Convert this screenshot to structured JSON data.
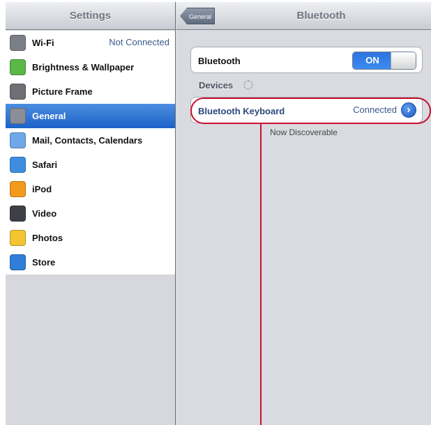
{
  "sidebar": {
    "title": "Settings",
    "items": [
      {
        "label": "Wi-Fi",
        "value": "Not Connected",
        "icon": "wifi-icon",
        "color": "#7b8088",
        "selected": false
      },
      {
        "label": "Brightness & Wallpaper",
        "icon": "brightness-icon",
        "color": "#59b848",
        "selected": false
      },
      {
        "label": "Picture Frame",
        "icon": "picture-frame-icon",
        "color": "#6d6f74",
        "selected": false
      },
      {
        "label": "General",
        "icon": "gear-icon",
        "color": "#8a8e96",
        "selected": true
      },
      {
        "label": "Mail, Contacts, Calendars",
        "icon": "mail-icon",
        "color": "#6fa8e8",
        "selected": false
      },
      {
        "label": "Safari",
        "icon": "safari-icon",
        "color": "#3e8ee0",
        "selected": false
      },
      {
        "label": "iPod",
        "icon": "ipod-icon",
        "color": "#f39a1d",
        "selected": false
      },
      {
        "label": "Video",
        "icon": "video-icon",
        "color": "#3d4147",
        "selected": false
      },
      {
        "label": "Photos",
        "icon": "photos-icon",
        "color": "#f2c531",
        "selected": false
      },
      {
        "label": "Store",
        "icon": "store-icon",
        "color": "#2f7fd8",
        "selected": false
      }
    ]
  },
  "detail": {
    "back_label": "General",
    "title": "Bluetooth",
    "bluetooth_label": "Bluetooth",
    "toggle_label": "ON",
    "devices_label": "Devices",
    "device_name": "Bluetooth Keyboard",
    "device_status": "Connected",
    "discoverable_text": "Now Discoverable"
  },
  "colors": {
    "selection": "#1c62c9",
    "accent_blue": "#3a5a8c",
    "annotation_red": "#c8102e"
  }
}
